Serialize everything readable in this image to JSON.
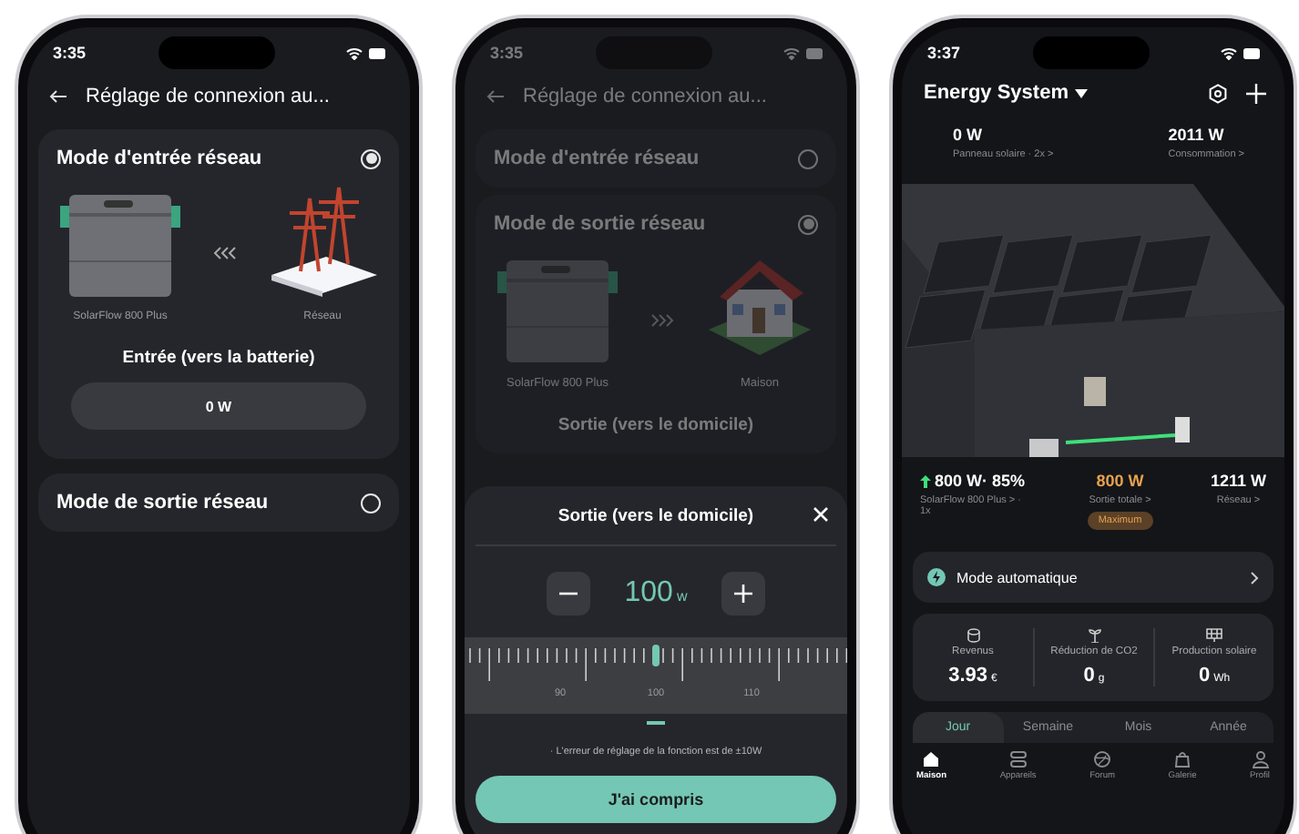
{
  "screens": [
    {
      "kind": "input",
      "time": "3:35",
      "title": "Réglage de connexion au...",
      "modes": [
        {
          "kind": "grid_in",
          "label": "Mode d'entrée réseau",
          "selected": true,
          "expanded": true,
          "device": "SolarFlow 800 Plus",
          "target": "Réseau",
          "field_label": "Entrée (vers la batterie)",
          "value": "0 W"
        },
        {
          "label": "Mode de sortie réseau",
          "selected": false,
          "expanded": false
        }
      ]
    },
    {
      "kind": "output",
      "time": "3:35",
      "title": "Réglage de connexion au...",
      "modes": [
        {
          "label": "Mode d'entrée réseau",
          "selected": false,
          "expanded": false
        },
        {
          "kind": "home_out",
          "label": "Mode de sortie réseau",
          "selected": true,
          "expanded": true,
          "device": "SolarFlow 800 Plus",
          "target": "Maison",
          "field_label": "Sortie (vers le domicile)"
        }
      ],
      "sheet": {
        "title": "Sortie (vers le domicile)",
        "value": "100",
        "unit": "w",
        "ticks": [
          "90",
          "100",
          "110"
        ],
        "level": 0.5,
        "note": "· L'erreur de réglage de la fonction est de ±10W",
        "button": "J'ai compris"
      }
    },
    {
      "kind": "home",
      "time": "3:37",
      "system": "Energy System",
      "top_stats": [
        {
          "value": "0 W",
          "label": "Panneau solaire · 2x >"
        },
        {
          "value": "2011 W",
          "label": "Consommation >"
        }
      ],
      "bottom_stats": [
        {
          "value": "800 W· 85%",
          "label": "SolarFlow 800 Plus > · 1x",
          "arrow": true,
          "highlight": false
        },
        {
          "value": "800 W",
          "label": "Sortie totale >",
          "badge": "Maximum",
          "arrow": false,
          "highlight": true
        },
        {
          "value": "1211 W",
          "label": "Réseau >",
          "arrow": false,
          "highlight": false
        }
      ],
      "mode": "Mode automatique",
      "metrics": [
        {
          "kind": "money",
          "label": "Revenus",
          "value": "3.93",
          "unit": "€"
        },
        {
          "kind": "plant",
          "label": "Réduction de CO2",
          "value": "0",
          "unit": "g"
        },
        {
          "kind": "solar",
          "label": "Production solaire",
          "value": "0",
          "unit": "Wh"
        }
      ],
      "periods": [
        {
          "label": "Jour",
          "selected": true
        },
        {
          "label": "Semaine",
          "selected": false
        },
        {
          "label": "Mois",
          "selected": false
        },
        {
          "label": "Année",
          "selected": false
        }
      ],
      "nav": [
        {
          "kind": "home",
          "label": "Maison",
          "selected": true
        },
        {
          "kind": "devices",
          "label": "Appareils",
          "selected": false
        },
        {
          "kind": "forum",
          "label": "Forum",
          "selected": false
        },
        {
          "kind": "gallery",
          "label": "Galerie",
          "selected": false
        },
        {
          "kind": "profile",
          "label": "Profil",
          "selected": false
        }
      ]
    }
  ]
}
